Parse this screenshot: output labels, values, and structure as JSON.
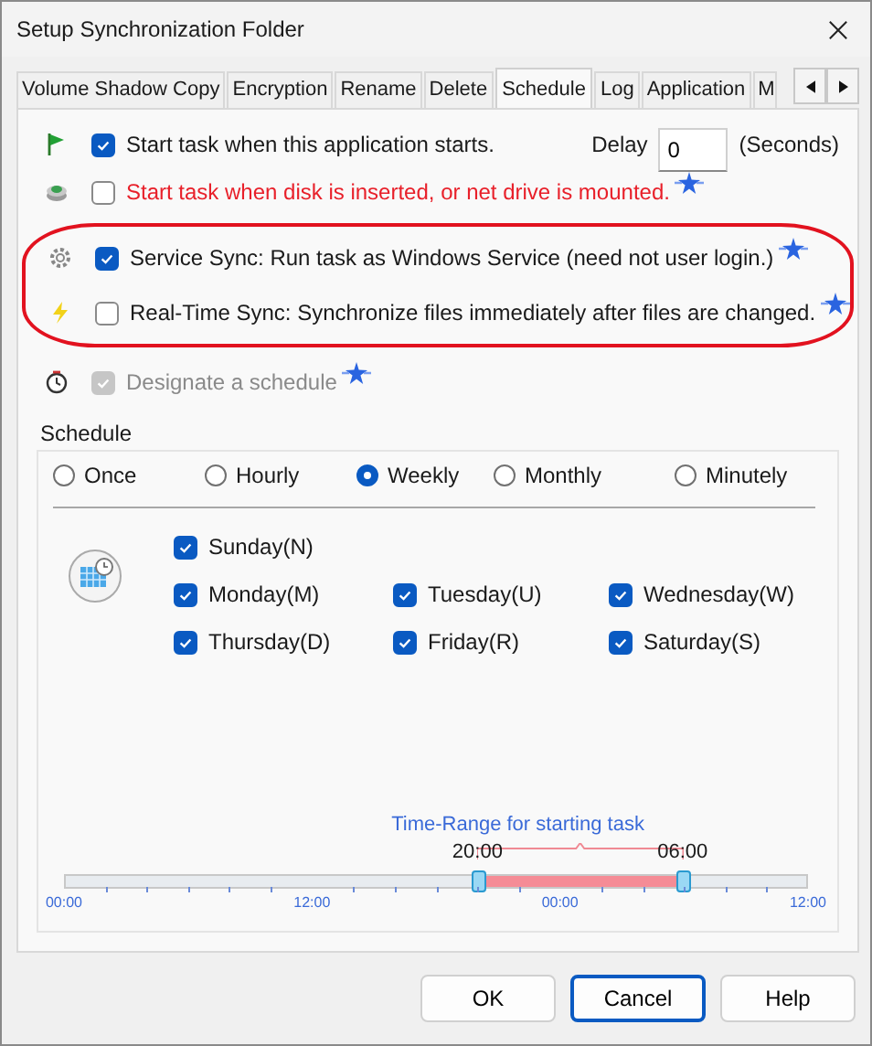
{
  "window": {
    "title": "Setup Synchronization Folder"
  },
  "tabs": [
    {
      "label": "Volume Shadow Copy",
      "selected": false
    },
    {
      "label": "Encryption",
      "selected": false
    },
    {
      "label": "Rename",
      "selected": false
    },
    {
      "label": "Delete",
      "selected": false
    },
    {
      "label": "Schedule",
      "selected": true
    },
    {
      "label": "Log",
      "selected": false
    },
    {
      "label": "Application",
      "selected": false
    },
    {
      "label": "M",
      "selected": false
    }
  ],
  "options": [
    {
      "label": "Start task when this application starts.",
      "checked": true,
      "disabled": false,
      "warning": false,
      "new": false,
      "highlighted": false,
      "delay": {
        "label": "Delay",
        "value": "0",
        "unit": "(Seconds)"
      }
    },
    {
      "label": "Start task when disk is inserted, or net drive is mounted.",
      "checked": false,
      "disabled": false,
      "warning": true,
      "new": true,
      "highlighted": false
    },
    {
      "label": "Service Sync: Run task as Windows Service (need not user login.)",
      "checked": true,
      "disabled": false,
      "warning": false,
      "new": true,
      "highlighted": true
    },
    {
      "label": "Real-Time Sync: Synchronize files immediately after files are changed.",
      "checked": false,
      "disabled": false,
      "warning": false,
      "new": true,
      "highlighted": true
    },
    {
      "label": "Designate a schedule",
      "checked": true,
      "disabled": true,
      "warning": false,
      "new": true,
      "highlighted": false
    }
  ],
  "schedule": {
    "label": "Schedule",
    "frequencies": [
      {
        "label": "Once",
        "selected": false
      },
      {
        "label": "Hourly",
        "selected": false
      },
      {
        "label": "Weekly",
        "selected": true
      },
      {
        "label": "Monthly",
        "selected": false
      },
      {
        "label": "Minutely",
        "selected": false
      }
    ],
    "days": [
      {
        "label": "Sunday(N)",
        "checked": true
      },
      {
        "label": "Monday(M)",
        "checked": true
      },
      {
        "label": "Tuesday(U)",
        "checked": true
      },
      {
        "label": "Wednesday(W)",
        "checked": true
      },
      {
        "label": "Thursday(D)",
        "checked": true
      },
      {
        "label": "Friday(R)",
        "checked": true
      },
      {
        "label": "Saturday(S)",
        "checked": true
      }
    ],
    "time_range": {
      "title": "Time-Range for starting task",
      "thumbs": [
        {
          "label": "20:00",
          "level": 0.556
        },
        {
          "label": "06:00",
          "level": 0.833
        }
      ],
      "ticks": [
        "00:00",
        "12:00",
        "00:00",
        "12:00"
      ]
    }
  },
  "buttons": [
    {
      "label": "OK",
      "default": false
    },
    {
      "label": "Cancel",
      "default": true
    },
    {
      "label": "Help",
      "default": false
    }
  ]
}
